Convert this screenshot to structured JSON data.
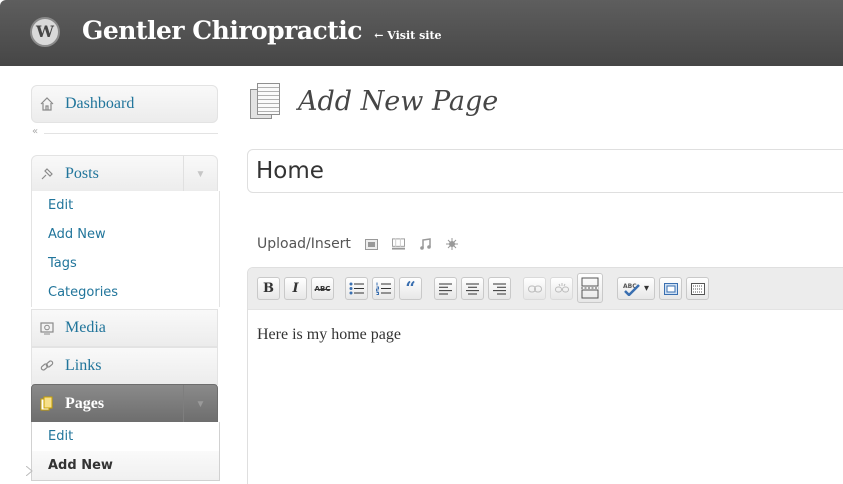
{
  "header": {
    "site_title": "Gentler Chiropractic",
    "visit_site": "← Visit site",
    "logo_letter": "W"
  },
  "sidebar": {
    "dashboard": "Dashboard",
    "collapse_glyph": "«",
    "posts": {
      "label": "Posts",
      "items": [
        "Edit",
        "Add New",
        "Tags",
        "Categories"
      ]
    },
    "media": "Media",
    "links": "Links",
    "pages": {
      "label": "Pages",
      "items": [
        "Edit",
        "Add New"
      ],
      "current": "Add New"
    },
    "toggle_glyph": "▼"
  },
  "main": {
    "page_title": "Add New Page",
    "title_value": "Home",
    "upload_label": "Upload/Insert",
    "editor_content": "Here is my home page",
    "toolbar": {
      "bold": "B",
      "italic": "I",
      "strikethrough": "ABC",
      "bullist": "☰",
      "numlist": "☰",
      "blockquote": "“",
      "align_left": "≡",
      "align_center": "≡",
      "align_right": "≡",
      "link": "∞",
      "unlink": "∞",
      "more": "═",
      "spellcheck": "✓",
      "dropdown": "▾",
      "fullscreen": "▣",
      "kitchen_sink": "☷"
    }
  },
  "colors": {
    "header_bg": "#464646",
    "link": "#21759b",
    "pages_active_bg": "#6d6d6d"
  }
}
